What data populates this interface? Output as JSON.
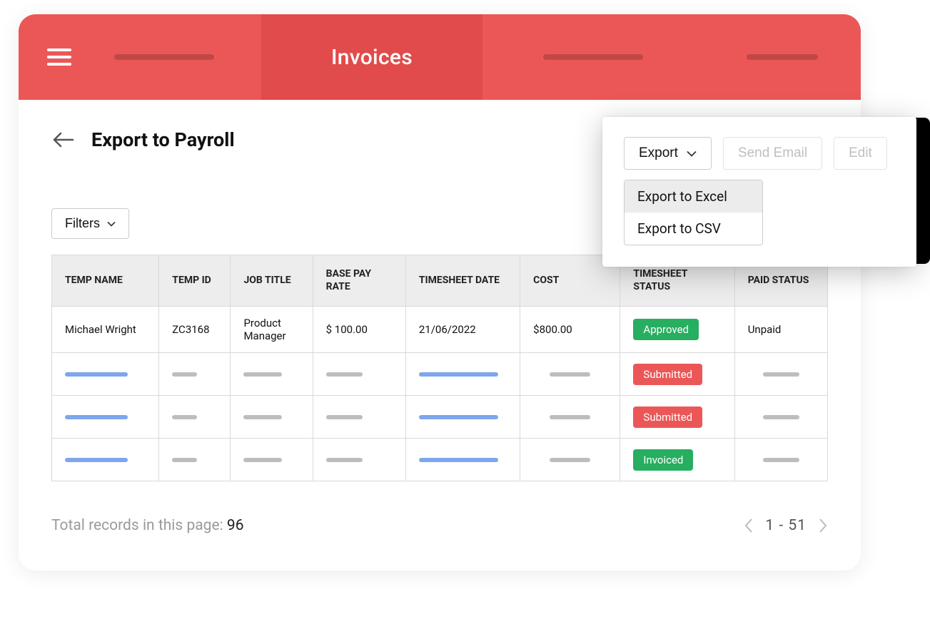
{
  "topbar": {
    "active_tab_label": "Invoices"
  },
  "page": {
    "title": "Export to Payroll"
  },
  "filters": {
    "label": "Filters"
  },
  "popover": {
    "export_label": "Export",
    "send_email_label": "Send Email",
    "edit_label": "Edit",
    "menu": {
      "export_excel": "Export to Excel",
      "export_csv": "Export to CSV"
    }
  },
  "table": {
    "headers": {
      "temp_name": "TEMP NAME",
      "temp_id": "TEMP ID",
      "job_title": "JOB TITLE",
      "base_pay_rate": "BASE PAY RATE",
      "timesheet_date": "TIMESHEET DATE",
      "cost": "COST",
      "timesheet_status": "TIMESHEET STATUS",
      "paid_status": "PAID STATUS"
    },
    "rows": [
      {
        "temp_name": "Michael Wright",
        "temp_id": "ZC3168",
        "job_title": "Product Manager",
        "base_pay_rate": "$ 100.00",
        "timesheet_date": "21/06/2022",
        "cost": "$800.00",
        "timesheet_status": "Approved",
        "timesheet_status_color": "green",
        "paid_status": "Unpaid"
      },
      {
        "timesheet_status": "Submitted",
        "timesheet_status_color": "red"
      },
      {
        "timesheet_status": "Submitted",
        "timesheet_status_color": "red"
      },
      {
        "timesheet_status": "Invoiced",
        "timesheet_status_color": "green"
      }
    ]
  },
  "footer": {
    "total_label": "Total records in this page: ",
    "total_count": "96",
    "page_range": "1 - 51"
  }
}
